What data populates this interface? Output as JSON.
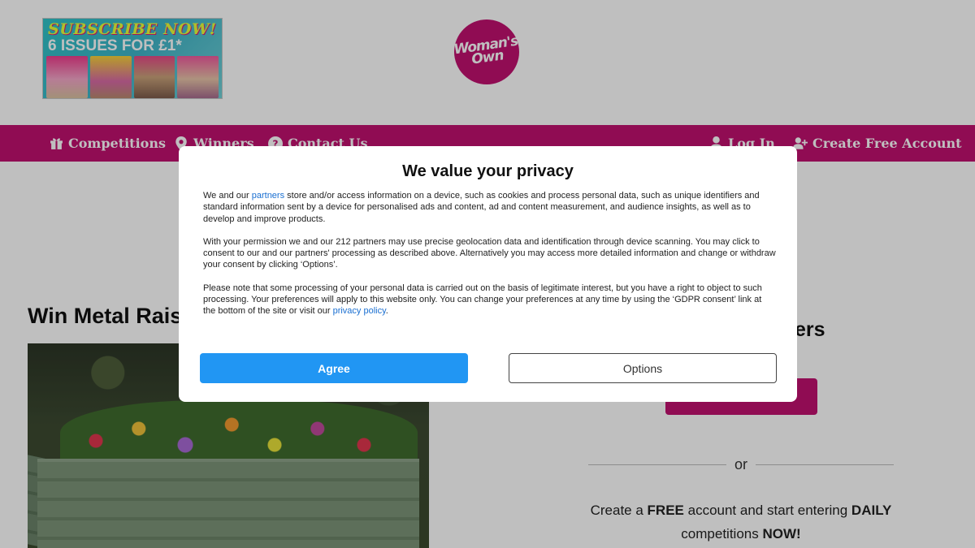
{
  "promo": {
    "line1": "SUBSCRIBE NOW!",
    "line2": "6 ISSUES FOR £1*"
  },
  "logo": {
    "text": "Woman's Own"
  },
  "nav": {
    "left": [
      {
        "label": "Competitions",
        "icon": "gift-icon"
      },
      {
        "label": "Winners",
        "icon": "map-pin-icon"
      },
      {
        "label": "Contact Us",
        "icon": "help-circle-icon"
      }
    ],
    "right": [
      {
        "label": "Log In",
        "icon": "user-icon"
      },
      {
        "label": "Create Free Account",
        "icon": "user-plus-icon"
      }
    ]
  },
  "main": {
    "title": "Win Metal Rais",
    "side_heading_fragment": "ers",
    "or_text": "or",
    "create": {
      "part1": "Create a ",
      "bold1": "FREE",
      "part2": " account and start entering ",
      "bold2": "DAILY",
      "part3": " competitions ",
      "bold3": "NOW!"
    }
  },
  "consent": {
    "title": "We value your privacy",
    "p1_pre": "We and our ",
    "p1_link": "partners",
    "p1_post": " store and/or access information on a device, such as cookies and process personal data, such as unique identifiers and standard information sent by a device for personalised ads and content, ad and content measurement, and audience insights, as well as to develop and improve products.",
    "p2": "With your permission we and our 212 partners may use precise geolocation data and identification through device scanning. You may click to consent to our and our partners' processing as described above. Alternatively you may access more detailed information and change or withdraw your consent by clicking ‘Options’.",
    "p3_pre": "Please note that some processing of your personal data is carried out on the basis of legitimate interest, but you have a right to object to such processing. Your preferences will apply to this website only. You can change your preferences at any time by using the ‘GDPR consent’ link at the bottom of the site or visit our ",
    "p3_link": "privacy policy",
    "p3_post": ".",
    "agree_label": "Agree",
    "options_label": "Options"
  },
  "colors": {
    "brand": "#c0106f",
    "agree": "#2196f3",
    "link": "#1a6fd1"
  }
}
